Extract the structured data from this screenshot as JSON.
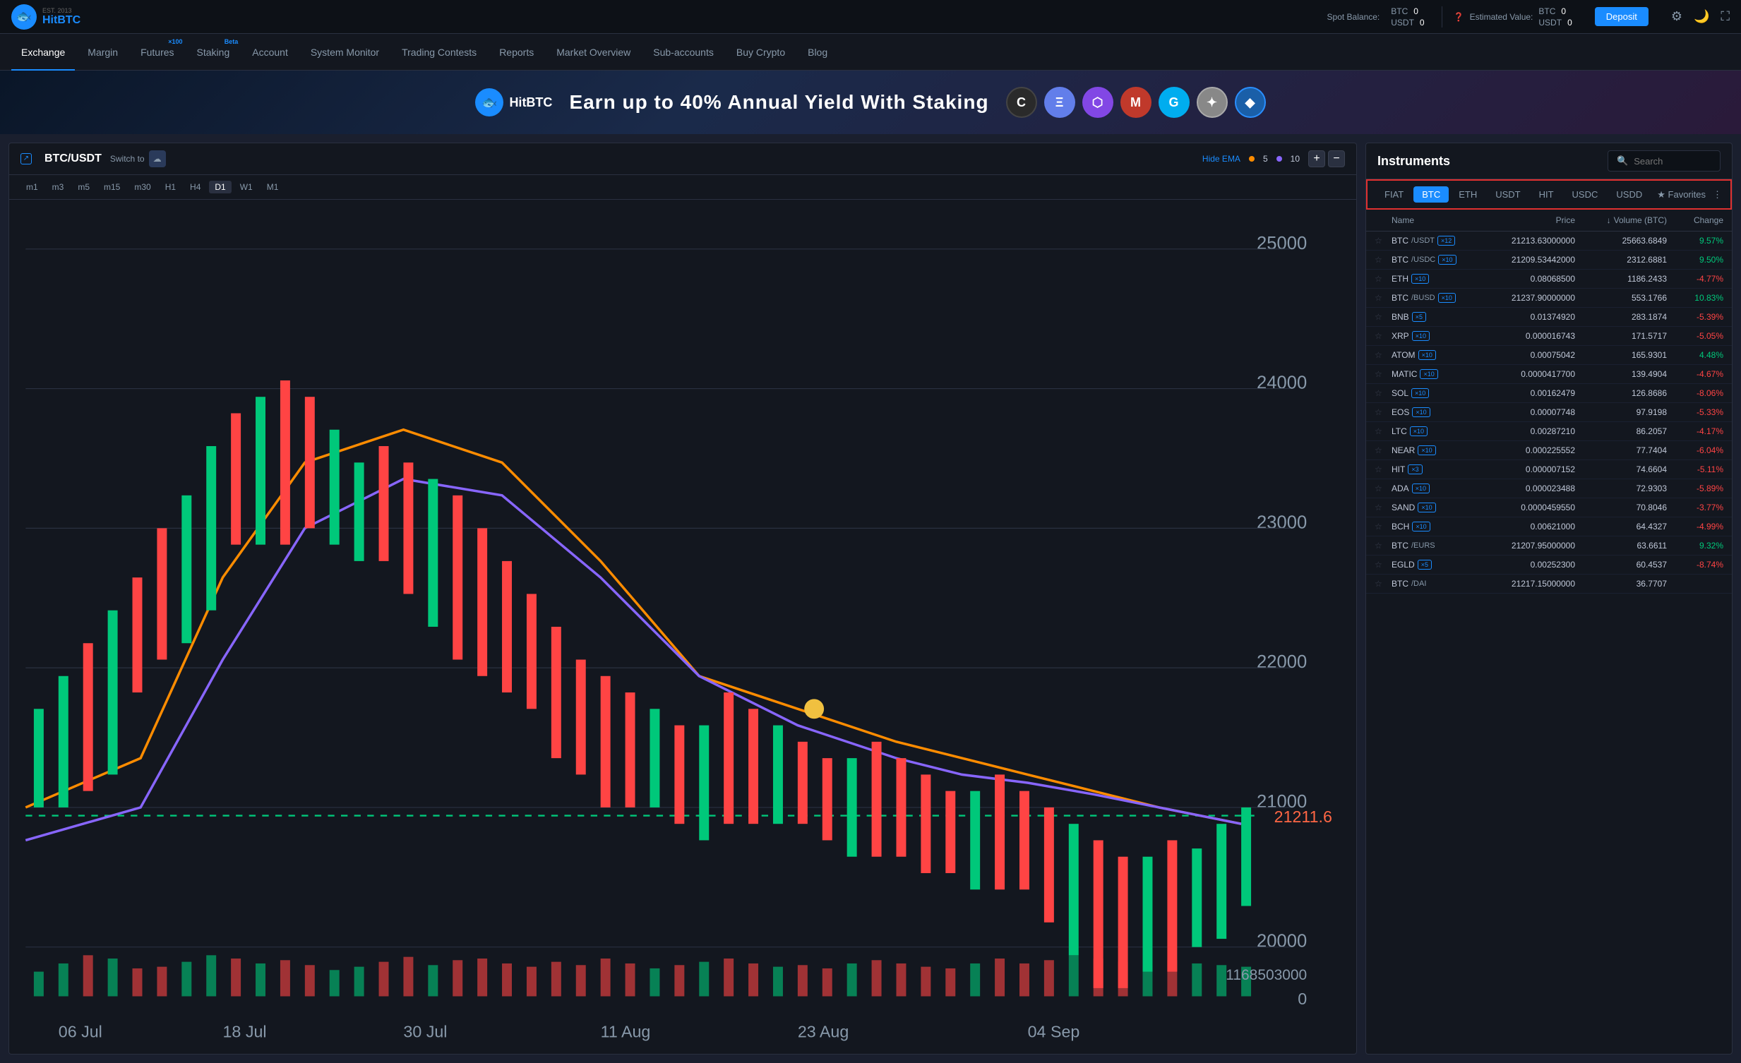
{
  "topbar": {
    "logo_est": "EST. 2013",
    "logo_name_hit": "Hit",
    "logo_name_btc": "BTC",
    "spot_balance_label": "Spot Balance:",
    "btc_label": "BTC",
    "btc_value": "0",
    "usdt_label": "USDT",
    "usdt_value": "0",
    "estimated_label": "Estimated Value:",
    "estimated_btc_label": "BTC",
    "estimated_btc_value": "0",
    "estimated_usdt_label": "USDT",
    "estimated_usdt_value": "0",
    "deposit_label": "Deposit"
  },
  "nav": {
    "items": [
      {
        "label": "Exchange",
        "active": true
      },
      {
        "label": "Margin",
        "active": false
      },
      {
        "label": "Futures",
        "active": false,
        "badge": "×100"
      },
      {
        "label": "Staking",
        "active": false,
        "badge": "Beta"
      },
      {
        "label": "Account",
        "active": false
      },
      {
        "label": "System Monitor",
        "active": false
      },
      {
        "label": "Trading Contests",
        "active": false
      },
      {
        "label": "Reports",
        "active": false
      },
      {
        "label": "Market Overview",
        "active": false
      },
      {
        "label": "Sub-accounts",
        "active": false
      },
      {
        "label": "Buy Crypto",
        "active": false
      },
      {
        "label": "Blog",
        "active": false
      }
    ]
  },
  "banner": {
    "text": "Earn up to 40% Annual Yield With Staking",
    "logo_text": "HitBTC"
  },
  "chart": {
    "symbol": "BTC/USDT",
    "switch_to": "Switch to",
    "hide_ema": "Hide EMA",
    "ema_5": "5",
    "ema_10": "10",
    "price_level": "21211.6",
    "timeframes": [
      "m1",
      "m3",
      "m5",
      "m15",
      "m30",
      "H1",
      "H4",
      "D1",
      "W1",
      "M1"
    ],
    "active_tf": "D1",
    "dates": [
      "06 Jul",
      "18 Jul",
      "30 Jul",
      "11 Aug",
      "23 Aug",
      "04 Sep"
    ]
  },
  "instruments": {
    "title": "Instruments",
    "search_placeholder": "Search",
    "tabs": [
      "FIAT",
      "BTC",
      "ETH",
      "USDT",
      "HIT",
      "USDC",
      "USDD"
    ],
    "active_tab": "BTC",
    "favorites_label": "★ Favorites",
    "columns": {
      "name": "Name",
      "price": "Price",
      "volume": "Volume (BTC)",
      "change": "Change"
    },
    "rows": [
      {
        "name": "BTC/USDT",
        "badge": "×12",
        "price": "21213.63000000",
        "volume": "25663.6849",
        "change": "9.57%",
        "pos": true
      },
      {
        "name": "BTC/USDC",
        "badge": "×10",
        "price": "21209.53442000",
        "volume": "2312.6881",
        "change": "9.50%",
        "pos": true
      },
      {
        "name": "ETH",
        "badge": "×10",
        "price": "0.08068500",
        "volume": "1186.2433",
        "change": "-4.77%",
        "pos": false
      },
      {
        "name": "BTC/BUSD",
        "badge": "×10",
        "price": "21237.90000000",
        "volume": "553.1766",
        "change": "10.83%",
        "pos": true
      },
      {
        "name": "BNB",
        "badge": "×5",
        "price": "0.01374920",
        "volume": "283.1874",
        "change": "-5.39%",
        "pos": false
      },
      {
        "name": "XRP",
        "badge": "×10",
        "price": "0.000016743",
        "volume": "171.5717",
        "change": "-5.05%",
        "pos": false
      },
      {
        "name": "ATOM",
        "badge": "×10",
        "price": "0.00075042",
        "volume": "165.9301",
        "change": "4.48%",
        "pos": true
      },
      {
        "name": "MATIC",
        "badge": "×10",
        "price": "0.0000417700",
        "volume": "139.4904",
        "change": "-4.67%",
        "pos": false
      },
      {
        "name": "SOL",
        "badge": "×10",
        "price": "0.00162479",
        "volume": "126.8686",
        "change": "-8.06%",
        "pos": false
      },
      {
        "name": "EOS",
        "badge": "×10",
        "price": "0.00007748",
        "volume": "97.9198",
        "change": "-5.33%",
        "pos": false
      },
      {
        "name": "LTC",
        "badge": "×10",
        "price": "0.00287210",
        "volume": "86.2057",
        "change": "-4.17%",
        "pos": false
      },
      {
        "name": "NEAR",
        "badge": "×10",
        "price": "0.000225552",
        "volume": "77.7404",
        "change": "-6.04%",
        "pos": false
      },
      {
        "name": "HIT",
        "badge": "×3",
        "price": "0.000007152",
        "volume": "74.6604",
        "change": "-5.11%",
        "pos": false
      },
      {
        "name": "ADA",
        "badge": "×10",
        "price": "0.000023488",
        "volume": "72.9303",
        "change": "-5.89%",
        "pos": false
      },
      {
        "name": "SAND",
        "badge": "×10",
        "price": "0.0000459550",
        "volume": "70.8046",
        "change": "-3.77%",
        "pos": false
      },
      {
        "name": "BCH",
        "badge": "×10",
        "price": "0.00621000",
        "volume": "64.4327",
        "change": "-4.99%",
        "pos": false
      },
      {
        "name": "BTC/EURS",
        "badge": null,
        "price": "21207.95000000",
        "volume": "63.6611",
        "change": "9.32%",
        "pos": true
      },
      {
        "name": "EGLD",
        "badge": "×5",
        "price": "0.00252300",
        "volume": "60.4537",
        "change": "-8.74%",
        "pos": false
      },
      {
        "name": "BTC/DAI",
        "badge": null,
        "price": "21217.15000000",
        "volume": "36.7707",
        "change": "",
        "pos": false
      }
    ]
  }
}
